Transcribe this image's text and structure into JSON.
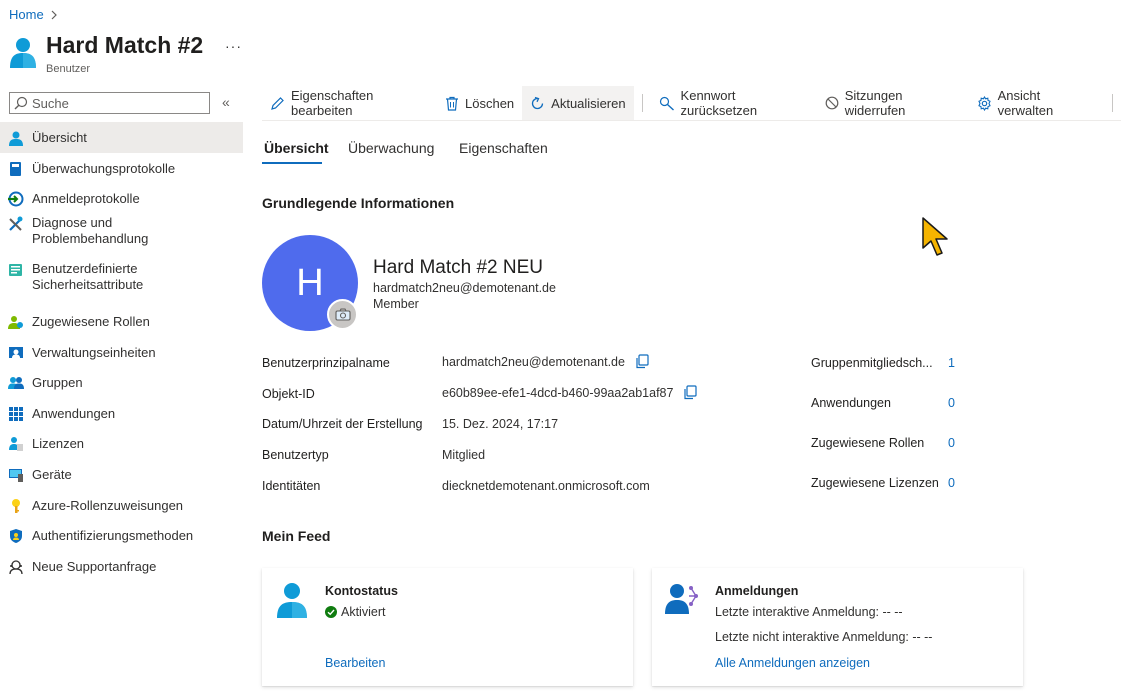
{
  "breadcrumb": {
    "home": "Home"
  },
  "header": {
    "title": "Hard Match #2",
    "subtitle": "Benutzer",
    "more": "···"
  },
  "search": {
    "placeholder": "Suche"
  },
  "sidebar": {
    "collapse": "«",
    "items": [
      {
        "label": "Übersicht",
        "icon": "user-icon"
      },
      {
        "label": "Überwachungsprotokolle",
        "icon": "book-icon"
      },
      {
        "label": "Anmeldeprotokolle",
        "icon": "sign-in-icon"
      },
      {
        "label": "Diagnose und Problembehandlung",
        "icon": "tools-icon"
      },
      {
        "label": "Benutzerdefinierte Sicherheitsattribute",
        "icon": "attributes-icon"
      },
      {
        "label": "Zugewiesene Rollen",
        "icon": "roles-icon"
      },
      {
        "label": "Verwaltungseinheiten",
        "icon": "admin-units-icon"
      },
      {
        "label": "Gruppen",
        "icon": "groups-icon"
      },
      {
        "label": "Anwendungen",
        "icon": "apps-grid-icon"
      },
      {
        "label": "Lizenzen",
        "icon": "license-icon"
      },
      {
        "label": "Geräte",
        "icon": "device-icon"
      },
      {
        "label": "Azure-Rollenzuweisungen",
        "icon": "key-icon"
      },
      {
        "label": "Authentifizierungsmethoden",
        "icon": "shield-icon"
      },
      {
        "label": "Neue Supportanfrage",
        "icon": "support-icon"
      }
    ]
  },
  "toolbar": {
    "edit": "Eigenschaften bearbeiten",
    "delete": "Löschen",
    "refresh": "Aktualisieren",
    "reset_password": "Kennwort zurücksetzen",
    "revoke_sessions": "Sitzungen widerrufen",
    "manage_view": "Ansicht verwalten"
  },
  "tabs": {
    "overview": "Übersicht",
    "monitoring": "Überwachung",
    "properties": "Eigenschaften"
  },
  "basic_info": {
    "heading": "Grundlegende Informationen",
    "avatar_initial": "H",
    "display_name": "Hard Match #2 NEU",
    "email": "hardmatch2neu@demotenant.de",
    "member": "Member"
  },
  "properties": {
    "upn_label": "Benutzerprinzipalname",
    "upn_value": "hardmatch2neu@demotenant.de",
    "objectid_label": "Objekt-ID",
    "objectid_value": "e60b89ee-efe1-4dcd-b460-99aa2ab1af87",
    "created_label": "Datum/Uhrzeit der Erstellung",
    "created_value": "15. Dez. 2024, 17:17",
    "usertype_label": "Benutzertyp",
    "usertype_value": "Mitglied",
    "identities_label": "Identitäten",
    "identities_value": "diecknetdemotenant.onmicrosoft.com"
  },
  "stats": {
    "groups_label": "Gruppenmitgliedsch...",
    "groups_value": "1",
    "apps_label": "Anwendungen",
    "apps_value": "0",
    "roles_label": "Zugewiesene Rollen",
    "roles_value": "0",
    "licenses_label": "Zugewiesene Lizenzen",
    "licenses_value": "0"
  },
  "feed": {
    "heading": "Mein Feed",
    "account": {
      "title": "Kontostatus",
      "status": "Aktiviert",
      "link": "Bearbeiten"
    },
    "signins": {
      "title": "Anmeldungen",
      "interactive": "Letzte interaktive Anmeldung: -- --",
      "non_interactive": "Letzte nicht interaktive Anmeldung: -- --",
      "link": "Alle Anmeldungen anzeigen"
    }
  },
  "colors": {
    "accent": "#0f6cbd",
    "avatar": "#4f6bed",
    "success": "#107c10",
    "cursor": "#f5b400"
  }
}
